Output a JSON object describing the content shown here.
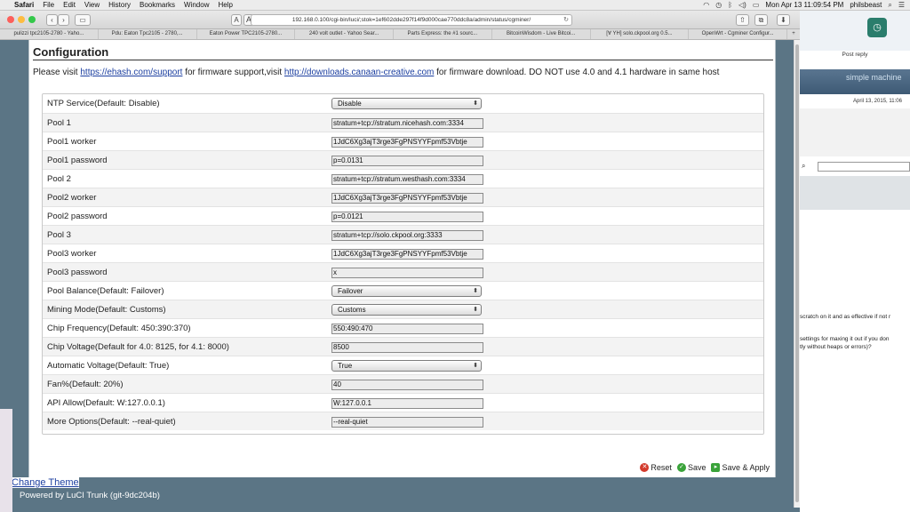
{
  "menubar": {
    "app": "Safari",
    "items": [
      "File",
      "Edit",
      "View",
      "History",
      "Bookmarks",
      "Window",
      "Help"
    ],
    "clock": "Mon Apr 13  11:09:54 PM",
    "user": "philsbeast"
  },
  "browser": {
    "url": "192.168.0.100/cgi-bin/luci/;stok=1ef602dde297f14f9d000cae770ddc8a/admin/status/cgminer/",
    "bookmarks": [
      "pulizzi tpc2105-2780 - Yaho...",
      "Pdu: Eaton Tpc2105 - 2780,...",
      "Eaton Power TPC2105-2780...",
      "240 volt outlet - Yahoo Sear...",
      "Parts Express: the #1 sourc...",
      "BitcoinWisdom - Live Bitcoi...",
      "[∀ YH] solo.ckpool.org 0.5...",
      "OpenWrt - Cgminer Configur..."
    ]
  },
  "page": {
    "title": "Configuration",
    "notice_prefix": "Please visit ",
    "notice_link1": "https://ehash.com/support",
    "notice_mid": " for firmware support,visit ",
    "notice_link2": "http://downloads.canaan-creative.com",
    "notice_suffix": " for firmware download. DO NOT use 4.0 and 4.1 hardware in same host"
  },
  "fields": [
    {
      "label": "NTP Service(Default: Disable)",
      "value": "Disable",
      "kind": "select"
    },
    {
      "label": "Pool 1",
      "value": "stratum+tcp://stratum.nicehash.com:3334",
      "kind": "input"
    },
    {
      "label": "Pool1 worker",
      "value": "1JdC6Xg3ajT3rge3FgPNSYYFpmf53Vbtje",
      "kind": "input"
    },
    {
      "label": "Pool1 password",
      "value": "p=0.0131",
      "kind": "input"
    },
    {
      "label": "Pool 2",
      "value": "stratum+tcp://stratum.westhash.com:3334",
      "kind": "input"
    },
    {
      "label": "Pool2 worker",
      "value": "1JdC6Xg3ajT3rge3FgPNSYYFpmf53Vbtje",
      "kind": "input"
    },
    {
      "label": "Pool2 password",
      "value": "p=0.0121",
      "kind": "input"
    },
    {
      "label": "Pool 3",
      "value": "stratum+tcp://solo.ckpool.org:3333",
      "kind": "input"
    },
    {
      "label": "Pool3 worker",
      "value": "1JdC6Xg3ajT3rge3FgPNSYYFpmf53Vbtje",
      "kind": "input"
    },
    {
      "label": "Pool3 password",
      "value": "x",
      "kind": "input"
    },
    {
      "label": "Pool Balance(Default: Failover)",
      "value": "Failover",
      "kind": "select"
    },
    {
      "label": "Mining Mode(Default: Customs)",
      "value": "Customs",
      "kind": "select"
    },
    {
      "label": "Chip Frequency(Default: 450:390:370)",
      "value": "550:490:470",
      "kind": "input"
    },
    {
      "label": "Chip Voltage(Default for 4.0: 8125, for 4.1: 8000)",
      "value": "8500",
      "kind": "input"
    },
    {
      "label": "Automatic Voltage(Default: True)",
      "value": "True",
      "kind": "select"
    },
    {
      "label": "Fan%(Default: 20%)",
      "value": "40",
      "kind": "input"
    },
    {
      "label": "API Allow(Default: W:127.0.0.1)",
      "value": "W:127.0.0.1",
      "kind": "input"
    },
    {
      "label": "More Options(Default: --real-quiet)",
      "value": "--real-quiet",
      "kind": "input"
    }
  ],
  "actions": {
    "reset": "Reset",
    "save": "Save",
    "save_apply": "Save & Apply"
  },
  "footer": {
    "change_theme": "Change Theme",
    "powered": "Powered by LuCI Trunk (git-9dc204b)"
  },
  "background_window": {
    "post_reply": "Post reply",
    "banner": "simple machine",
    "date": "April 13, 2015, 11:06",
    "line1": "scratch on it and as effective if not r",
    "line2": "settings for maxing it out if you don",
    "line3": "tly without heaps or errors)?"
  },
  "colors": {
    "page_bg": "#5b7585",
    "link": "#1c3fa0",
    "reset_icon": "#d33a2c",
    "save_icon": "#3aa33a"
  }
}
